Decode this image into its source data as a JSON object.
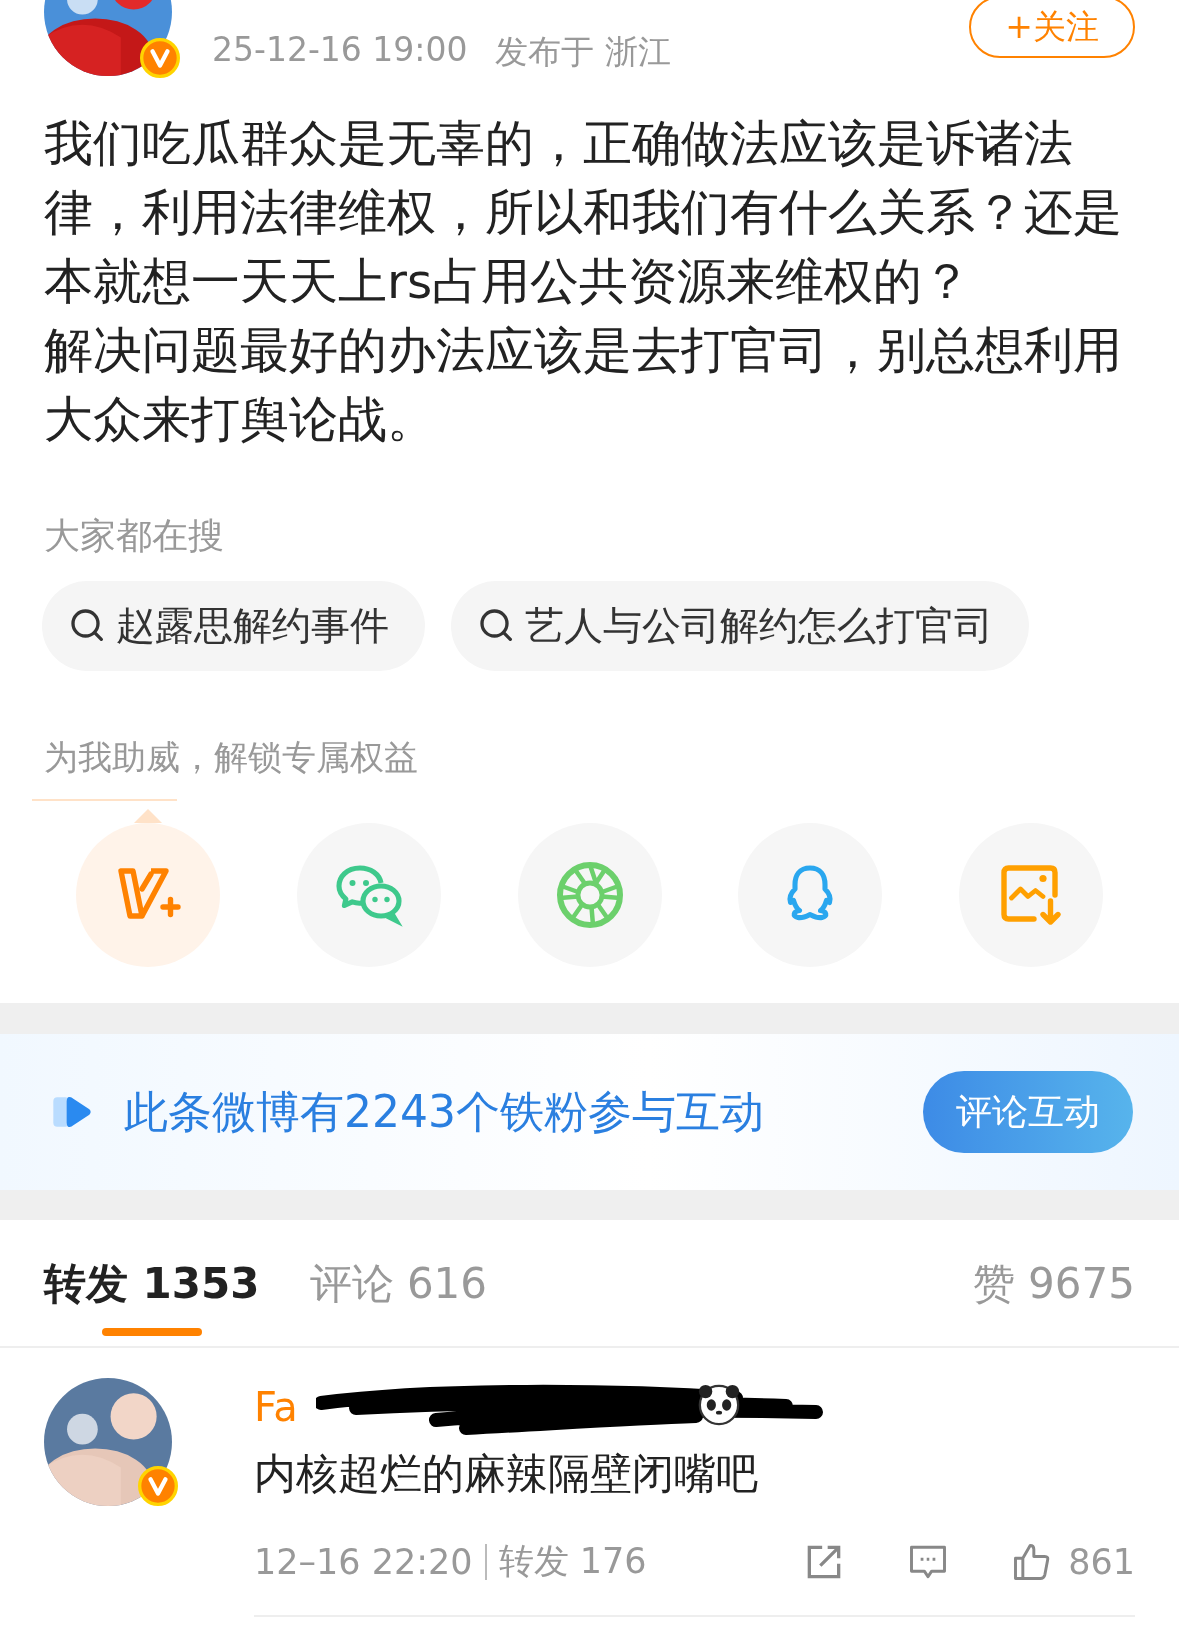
{
  "post": {
    "verified": true,
    "timestamp": "25-12-16 19:00",
    "location": "发布于 浙江",
    "follow_button": "+关注",
    "body": [
      [
        "我们吃瓜群众是无辜的，正确做法应该是诉诸法",
        "律，利用法律维权，所以和我们有什么关系？还是",
        "本就想一天天上rs占用公共资源来维权的？"
      ],
      [
        "解决问题最好的办法应该是去打官司，别总想利用",
        "大众来打舆论战。"
      ]
    ]
  },
  "trending": {
    "title": "大家都在搜",
    "chips": [
      "赵露思解约事件",
      "艺人与公司解约怎么打官司"
    ]
  },
  "share": {
    "title": "为我助威，解锁专属权益",
    "options": [
      {
        "kind": "vplus",
        "selected": true
      },
      {
        "kind": "wechat",
        "selected": false
      },
      {
        "kind": "aperture",
        "selected": false
      },
      {
        "kind": "qq",
        "selected": false
      },
      {
        "kind": "save-image",
        "selected": false
      }
    ]
  },
  "banner": {
    "text": "此条微博有2243个铁粉参与互动",
    "button": "评论互动"
  },
  "tabs": [
    {
      "label": "转发 ",
      "count": "1353",
      "selected": true
    },
    {
      "label": "评论 ",
      "count": "616",
      "selected": false
    }
  ],
  "likes": "赞 9675",
  "comments": [
    {
      "name": "Fa",
      "verified": true,
      "text": "内核超烂的麻辣隔壁闭嘴吧",
      "time": "12–16 22:20",
      "reposts": "转发 176",
      "like_count": "861"
    }
  ]
}
